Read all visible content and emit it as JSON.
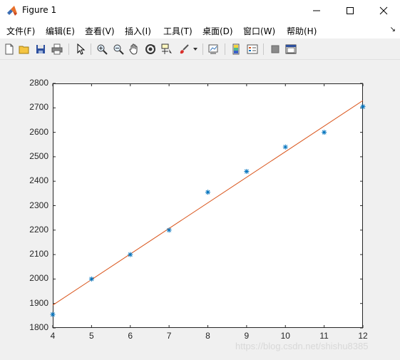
{
  "window": {
    "title": "Figure 1"
  },
  "menu": {
    "items": [
      "文件(F)",
      "编辑(E)",
      "查看(V)",
      "插入(I)",
      "工具(T)",
      "桌面(D)",
      "窗口(W)",
      "帮助(H)"
    ],
    "overflow": "↘"
  },
  "toolbar": {
    "icons": [
      "new-figure-icon",
      "open-file-icon",
      "save-icon",
      "print-icon",
      "select-arrow-icon",
      "zoom-in-icon",
      "zoom-out-icon",
      "pan-hand-icon",
      "rotate-3d-icon",
      "data-cursor-icon",
      "brush-icon",
      "brush-dropdown-icon",
      "link-plot-icon",
      "colorbar-icon",
      "legend-icon",
      "hide-plot-tools-icon",
      "show-plot-tools-icon"
    ]
  },
  "chart_data": {
    "type": "scatter",
    "x": [
      4,
      5,
      6,
      7,
      8,
      9,
      10,
      11,
      12
    ],
    "series": [
      {
        "values": [
          1855,
          2000,
          2100,
          2200,
          2355,
          2440,
          2540,
          2600,
          2705
        ],
        "marker": "*",
        "color": "#0072bd"
      },
      {
        "type": "line",
        "x": [
          4,
          12
        ],
        "values": [
          1893,
          2730
        ],
        "color": "#d95319"
      }
    ],
    "xlim": [
      4,
      12
    ],
    "ylim": [
      1800,
      2800
    ],
    "xticks": [
      "4",
      "5",
      "6",
      "7",
      "8",
      "9",
      "10",
      "11",
      "12"
    ],
    "yticks": [
      "1800",
      "1900",
      "2000",
      "2100",
      "2200",
      "2300",
      "2400",
      "2500",
      "2600",
      "2700",
      "2800"
    ],
    "grid": false
  },
  "watermark": "https://blog.csdn.net/shishu8385"
}
